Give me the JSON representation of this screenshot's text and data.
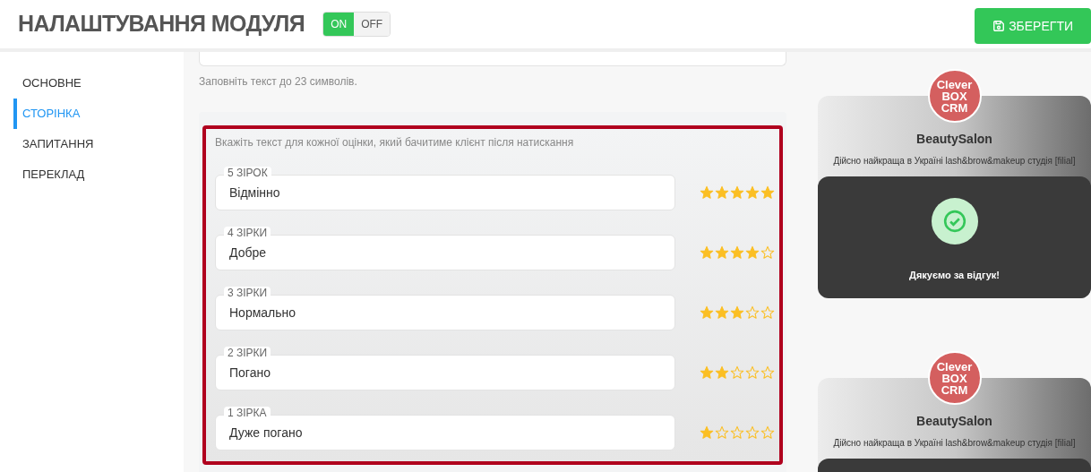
{
  "header": {
    "title": "НАЛАШТУВАННЯ МОДУЛЯ",
    "module_switch": {
      "on_label": "ON",
      "off_label": "OFF",
      "on": true
    },
    "save_button": "ЗБЕРЕГТИ"
  },
  "sidebar": {
    "items": [
      {
        "label": "ОСНОВНЕ",
        "selected": false
      },
      {
        "label": "СТОРІНКА",
        "selected": true
      },
      {
        "label": "ЗАПИТАННЯ",
        "selected": false
      },
      {
        "label": "ПЕРЕКЛАД",
        "selected": false
      }
    ]
  },
  "top_field": {
    "hint": "Заповніть текст до 23 символів."
  },
  "ratings_section": {
    "instruction": "Вкажіть текст для кожної оцінки, який бачитиме клієнт після натискання",
    "ratings": [
      {
        "label": "5 ЗІРОК",
        "value": "Відмінно",
        "stars": 5
      },
      {
        "label": "4 ЗІРКИ",
        "value": "Добре",
        "stars": 4
      },
      {
        "label": "3 ЗІРКИ",
        "value": "Нормально",
        "stars": 3
      },
      {
        "label": "2 ЗІРКИ",
        "value": "Погано",
        "stars": 2
      },
      {
        "label": "1 ЗІРКА",
        "value": "Дуже погано",
        "stars": 1
      }
    ]
  },
  "preview": {
    "cards": [
      {
        "logo": [
          "Clever",
          "BOX",
          "CRM"
        ],
        "name": "BeautySalon",
        "tagline": "Дійсно найкраща в Україні lash&brow&makeup студія [filial]",
        "message": "Дякуємо за відгук!"
      },
      {
        "logo": [
          "Clever",
          "BOX",
          "CRM"
        ],
        "name": "BeautySalon",
        "tagline": "Дійсно найкраща в Україні lash&brow&makeup студія [filial]"
      }
    ]
  }
}
